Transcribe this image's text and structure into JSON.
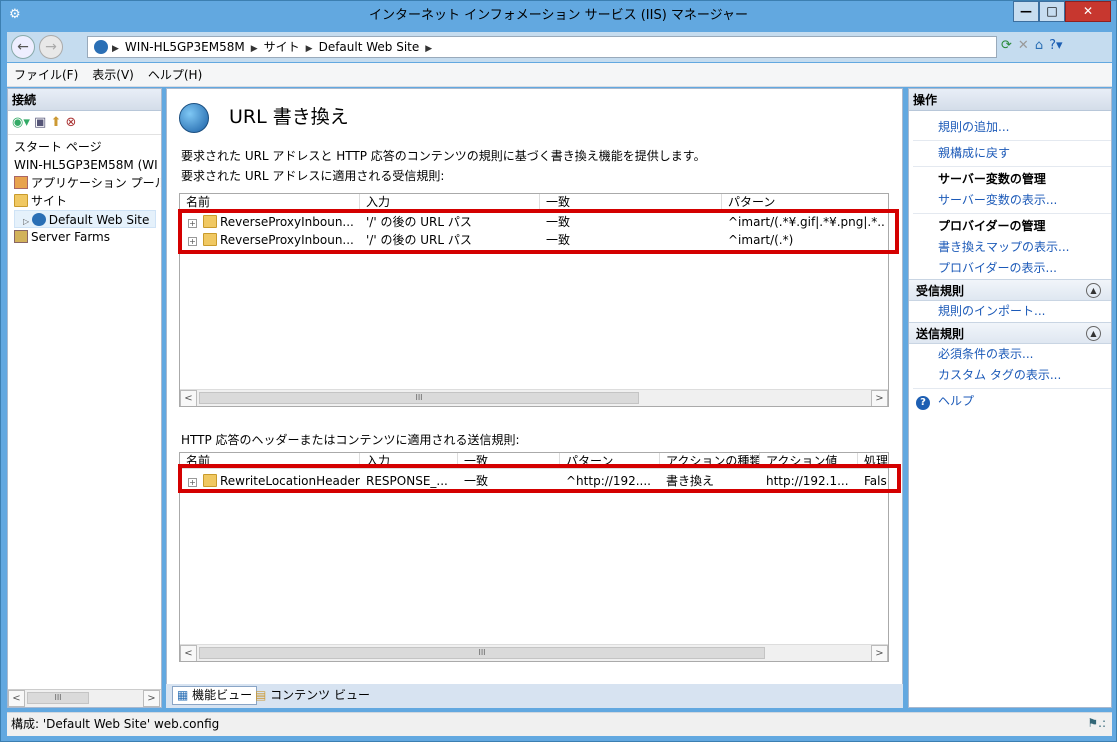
{
  "window": {
    "title": "インターネット インフォメーション サービス (IIS) マネージャー"
  },
  "breadcrumb": [
    "WIN-HL5GP3EM58M",
    "サイト",
    "Default Web Site"
  ],
  "menu": [
    "ファイル(F)",
    "表示(V)",
    "ヘルプ(H)"
  ],
  "connections": {
    "header": "接続",
    "tree": [
      {
        "label": "スタート ページ"
      },
      {
        "label": "WIN-HL5GP3EM58M (WI"
      },
      {
        "label": "アプリケーション プール"
      },
      {
        "label": "サイト"
      },
      {
        "label": "Default Web Site"
      },
      {
        "label": "Server Farms"
      }
    ],
    "scroll_thumb": "III"
  },
  "main": {
    "title": "URL 書き換え",
    "description": "要求された URL アドレスと HTTP 応答のコンテンツの規則に基づく書き換え機能を提供します。",
    "inbound_label": "要求された URL アドレスに適用される受信規則:",
    "inbound_columns": [
      "名前",
      "入力",
      "一致",
      "パターン"
    ],
    "inbound_rows": [
      {
        "name": "ReverseProxyInboun...",
        "input": "'/' の後の URL パス",
        "match": "一致",
        "pattern": "^imart/(.*¥.gif|.*¥.png|.*.."
      },
      {
        "name": "ReverseProxyInboun...",
        "input": "'/' の後の URL パス",
        "match": "一致",
        "pattern": "^imart/(.*)"
      }
    ],
    "outbound_label": "HTTP 応答のヘッダーまたはコンテンツに適用される送信規則:",
    "outbound_columns": [
      "名前",
      "入力",
      "一致",
      "パターン",
      "アクションの種類",
      "アクション値",
      "処理"
    ],
    "outbound_rows": [
      {
        "name": "RewriteLocationHeader",
        "input": "RESPONSE_...",
        "match": "一致",
        "pattern": "^http://192....",
        "action_type": "書き換え",
        "action_value": "http://192.1...",
        "stop": "Fals"
      }
    ],
    "scroll_thumb": "III"
  },
  "view_tabs": {
    "feature": "機能ビュー",
    "content": "コンテンツ ビュー"
  },
  "actions": {
    "header": "操作",
    "add_rule": "規則の追加...",
    "revert": "親構成に戻す",
    "server_vars_head": "サーバー変数の管理",
    "server_vars_view": "サーバー変数の表示...",
    "providers_head": "プロバイダーの管理",
    "rewrite_maps": "書き換えマップの表示...",
    "providers_view": "プロバイダーの表示...",
    "inbound_section": "受信規則",
    "import_rules": "規則のインポート...",
    "outbound_section": "送信規則",
    "preconditions": "必須条件の表示...",
    "custom_tags": "カスタム タグの表示...",
    "help": "ヘルプ"
  },
  "status": {
    "text": "構成: 'Default Web Site' web.config"
  },
  "colors": {
    "titlebar": "#62a8e0",
    "link": "#1c5ab8",
    "highlight": "#d40000"
  }
}
